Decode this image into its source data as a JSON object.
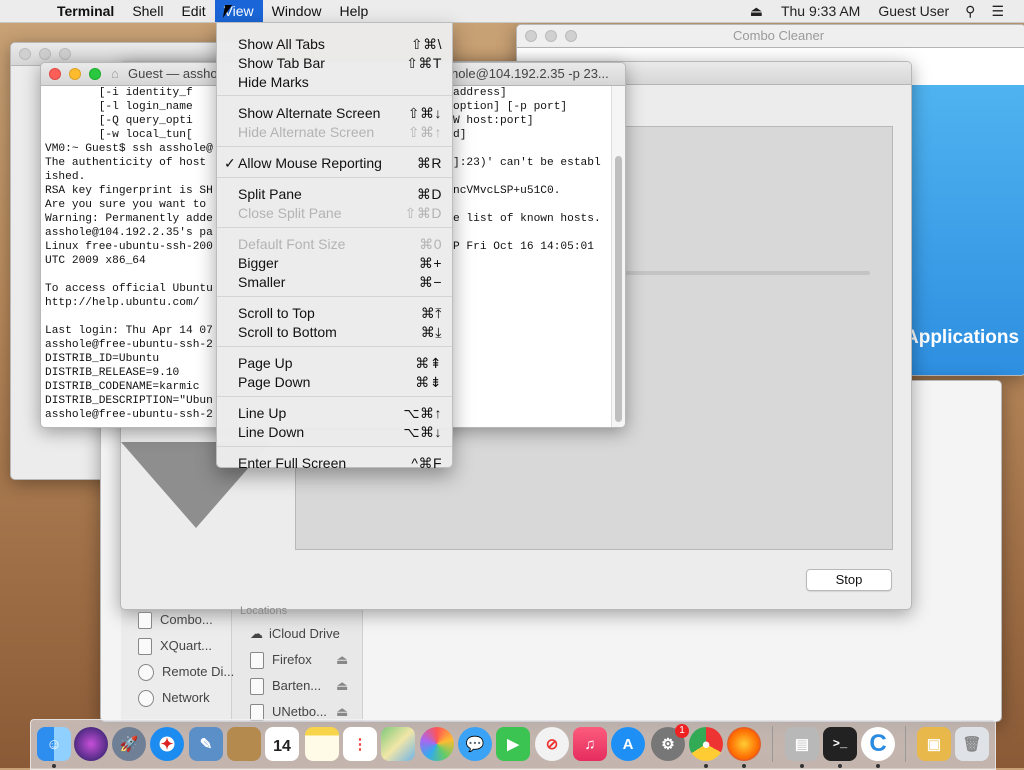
{
  "menubar": {
    "app": "Terminal",
    "items": [
      "Shell",
      "Edit",
      "View",
      "Window",
      "Help"
    ],
    "active": "View",
    "clock": "Thu 9:33 AM",
    "user": "Guest User"
  },
  "view_menu": [
    {
      "label": "Show All Tabs",
      "shortcut": "⇧⌘\\",
      "enabled": true
    },
    {
      "label": "Show Tab Bar",
      "shortcut": "⇧⌘T",
      "enabled": true
    },
    {
      "label": "Hide Marks",
      "shortcut": "",
      "enabled": true
    },
    {
      "label": "Show Alternate Screen",
      "shortcut": "⇧⌘↓",
      "enabled": true
    },
    {
      "label": "Hide Alternate Screen",
      "shortcut": "⇧⌘↑",
      "enabled": false
    },
    {
      "label": "Allow Mouse Reporting",
      "shortcut": "⌘R",
      "enabled": true,
      "checked": true
    },
    {
      "label": "Split Pane",
      "shortcut": "⌘D",
      "enabled": true
    },
    {
      "label": "Close Split Pane",
      "shortcut": "⇧⌘D",
      "enabled": false
    },
    {
      "label": "Default Font Size",
      "shortcut": "⌘0",
      "enabled": false
    },
    {
      "label": "Bigger",
      "shortcut": "⌘+",
      "enabled": true
    },
    {
      "label": "Smaller",
      "shortcut": "⌘−",
      "enabled": true
    },
    {
      "label": "Scroll to Top",
      "shortcut": "⌘⤒",
      "enabled": true
    },
    {
      "label": "Scroll to Bottom",
      "shortcut": "⌘⤓",
      "enabled": true
    },
    {
      "label": "Page Up",
      "shortcut": "⌘⇞",
      "enabled": true
    },
    {
      "label": "Page Down",
      "shortcut": "⌘⇟",
      "enabled": true
    },
    {
      "label": "Line Up",
      "shortcut": "⌥⌘↑",
      "enabled": true
    },
    {
      "label": "Line Down",
      "shortcut": "⌥⌘↓",
      "enabled": true
    },
    {
      "label": "Enter Full Screen",
      "shortcut": "^⌘F",
      "enabled": true
    }
  ],
  "terminal": {
    "title_left": "Guest — assho",
    "title_right": "hole@104.192.2.35 -p 23...",
    "lines_left": [
      "        [-i identity_f",
      "        [-l login_name",
      "        [-Q query_opti",
      "        [-w local_tun[",
      "VM0:~ Guest$ ssh asshole@",
      "The authenticity of host",
      "ished.",
      "RSA key fingerprint is SH",
      "Are you sure you want to",
      "Warning: Permanently adde",
      "asshole@104.192.2.35's pa",
      "Linux free-ubuntu-ssh-200",
      "UTC 2009 x86_64",
      "",
      "To access official Ubuntu",
      "http://help.ubuntu.com/",
      "",
      "Last login: Thu Apr 14 07",
      "asshole@free-ubuntu-ssh-2",
      "DISTRIB_ID=Ubuntu",
      "DISTRIB_RELEASE=9.10",
      "DISTRIB_CODENAME=karmic",
      "DISTRIB_DESCRIPTION=\"Ubun",
      "asshole@free-ubuntu-ssh-2"
    ],
    "lines_right": [
      "address]",
      "option] [-p port]",
      "W host:port]",
      "d]",
      "",
      "]:23)' can't be establ",
      "",
      "ncVMvcLSP+u51C0.",
      "",
      "e list of known hosts.",
      "",
      "P Fri Oct 16 14:05:01"
    ]
  },
  "combo_cleaner": {
    "title": "Combo Cleaner",
    "applications_label": "Applications"
  },
  "progress_window": {
    "stop_label": "Stop"
  },
  "finder": {
    "locations_heading": "Locations",
    "left_items": [
      "Combo...",
      "XQuart...",
      "Remote Di...",
      "Network"
    ],
    "locations": [
      "iCloud Drive",
      "Firefox",
      "Barten...",
      "UNetbo..."
    ]
  },
  "dock": {
    "calendar_day": "14",
    "appstore_badge": "1",
    "terminal_glyph": ">_"
  }
}
